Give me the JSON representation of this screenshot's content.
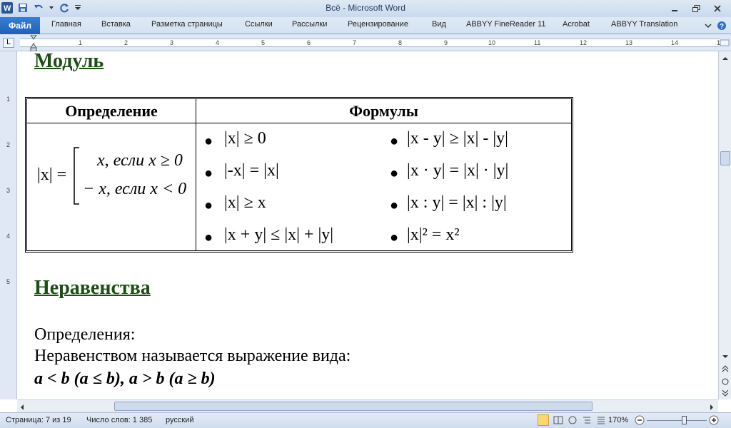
{
  "window": {
    "title": "Всё  -  Microsoft Word"
  },
  "ribbon": {
    "file_tab": "Файл",
    "tabs": [
      "Главная",
      "Вставка",
      "Разметка страницы",
      "Ссылки",
      "Рассылки",
      "Рецензирование",
      "Вид",
      "ABBYY FineReader 11",
      "Acrobat",
      "ABBYY Translation"
    ]
  },
  "ruler": {
    "numbers": [
      "1",
      "2",
      "1",
      "2",
      "3",
      "4",
      "5",
      "6",
      "7",
      "8",
      "9",
      "10",
      "11",
      "12",
      "13",
      "14",
      "15"
    ]
  },
  "vruler": {
    "numbers": [
      "1",
      "1",
      "2",
      "3",
      "4",
      "5"
    ]
  },
  "document": {
    "heading_modul": "Модуль",
    "table": {
      "col1_header": "Определение",
      "col2_header": "Формулы",
      "def_left": "|x| =",
      "def_case1": "x, если x ≥ 0",
      "def_case2": "− x, если x < 0",
      "formulas_left": [
        "|x| ≥ 0",
        "|-x| = |x|",
        "|x| ≥ x",
        "|x + y| ≤ |x| + |y|"
      ],
      "formulas_right": [
        "|x - y| ≥ |x| - |y|",
        "|x · y| = |x| · |y|",
        "|x : y| = |x| : |y|",
        "|x|² = x²"
      ],
      "bullet": "●"
    },
    "heading_ineq": "Неравенства",
    "para1": "Определения:",
    "para2": "Неравенством называется выражение вида:",
    "para3": "a < b   (a ≤ b),      a > b   (a ≥ b)"
  },
  "status": {
    "page": "Страница: 7 из 19",
    "words": "Число слов: 1 385",
    "language": "русский",
    "zoom": "170%"
  }
}
